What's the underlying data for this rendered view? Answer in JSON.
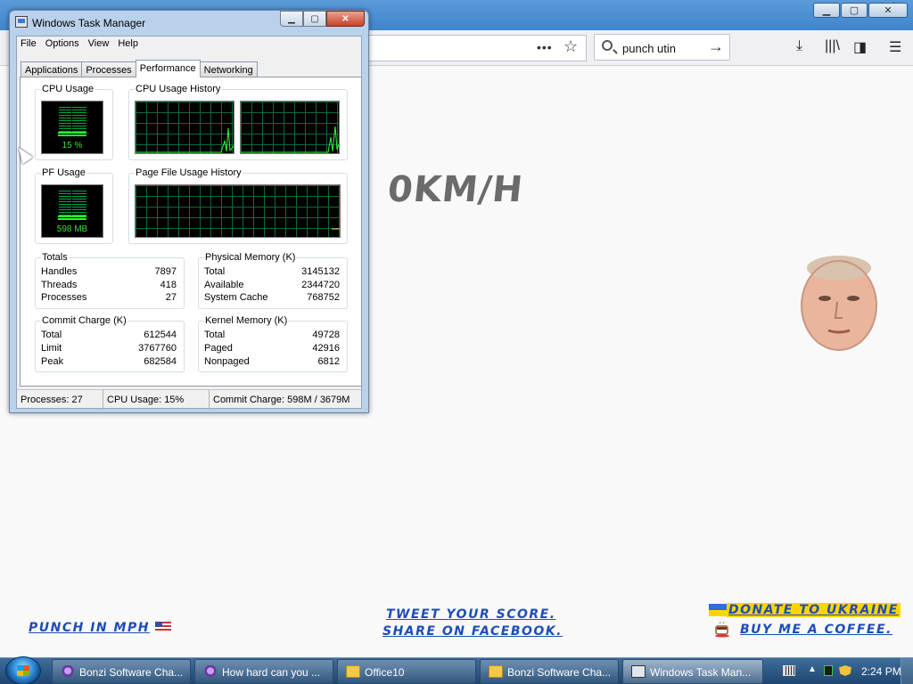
{
  "browser": {
    "search": {
      "value": "punch utin"
    },
    "page": {
      "speed": "0KM/H",
      "punch_link": "PUNCH IN MPH",
      "tweet_link": "TWEET YOUR SCORE.",
      "share_link": "SHARE ON FACEBOOK.",
      "donate_link": "DONATE TO UKRAINE",
      "coffee_link": "BUY ME A COFFEE."
    },
    "window_buttons": {
      "minimize": "▁",
      "maximize": "▢",
      "close": "✕"
    }
  },
  "taskmgr": {
    "title": "Windows Task Manager",
    "buttons": {
      "minimize": "▁",
      "maximize": "▢",
      "close": "✕"
    },
    "menu": [
      "File",
      "Options",
      "View",
      "Help"
    ],
    "tabs": [
      "Applications",
      "Processes",
      "Performance",
      "Networking"
    ],
    "active_tab": "Performance",
    "cpu_usage": {
      "title": "CPU Usage",
      "value": "15 %",
      "fraction": 0.15
    },
    "cpu_history": {
      "title": "CPU Usage History"
    },
    "pf_usage": {
      "title": "PF Usage",
      "value": "598 MB",
      "fraction": 0.16
    },
    "pf_history": {
      "title": "Page File Usage History"
    },
    "totals": {
      "title": "Totals",
      "rows": [
        {
          "label": "Handles",
          "value": "7897"
        },
        {
          "label": "Threads",
          "value": "418"
        },
        {
          "label": "Processes",
          "value": "27"
        }
      ]
    },
    "physical_memory": {
      "title": "Physical Memory (K)",
      "rows": [
        {
          "label": "Total",
          "value": "3145132"
        },
        {
          "label": "Available",
          "value": "2344720"
        },
        {
          "label": "System Cache",
          "value": "768752"
        }
      ]
    },
    "commit_charge": {
      "title": "Commit Charge (K)",
      "rows": [
        {
          "label": "Total",
          "value": "612544"
        },
        {
          "label": "Limit",
          "value": "3767760"
        },
        {
          "label": "Peak",
          "value": "682584"
        }
      ]
    },
    "kernel_memory": {
      "title": "Kernel Memory (K)",
      "rows": [
        {
          "label": "Total",
          "value": "49728"
        },
        {
          "label": "Paged",
          "value": "42916"
        },
        {
          "label": "Nonpaged",
          "value": "6812"
        }
      ]
    },
    "status": {
      "processes": "Processes: 27",
      "cpu": "CPU Usage: 15%",
      "commit": "Commit Charge: 598M / 3679M"
    }
  },
  "taskbar": {
    "items": [
      {
        "label": "Bonzi Software Cha...",
        "icon": "bonzi-icon"
      },
      {
        "label": "How hard can you ...",
        "icon": "bonzi-icon"
      },
      {
        "label": "Office10",
        "icon": "folder-icon"
      },
      {
        "label": "Bonzi Software Cha...",
        "icon": "folder-icon"
      },
      {
        "label": "Windows Task Man...",
        "icon": "task-manager-icon",
        "active": true
      }
    ],
    "clock": "2:24 PM"
  }
}
